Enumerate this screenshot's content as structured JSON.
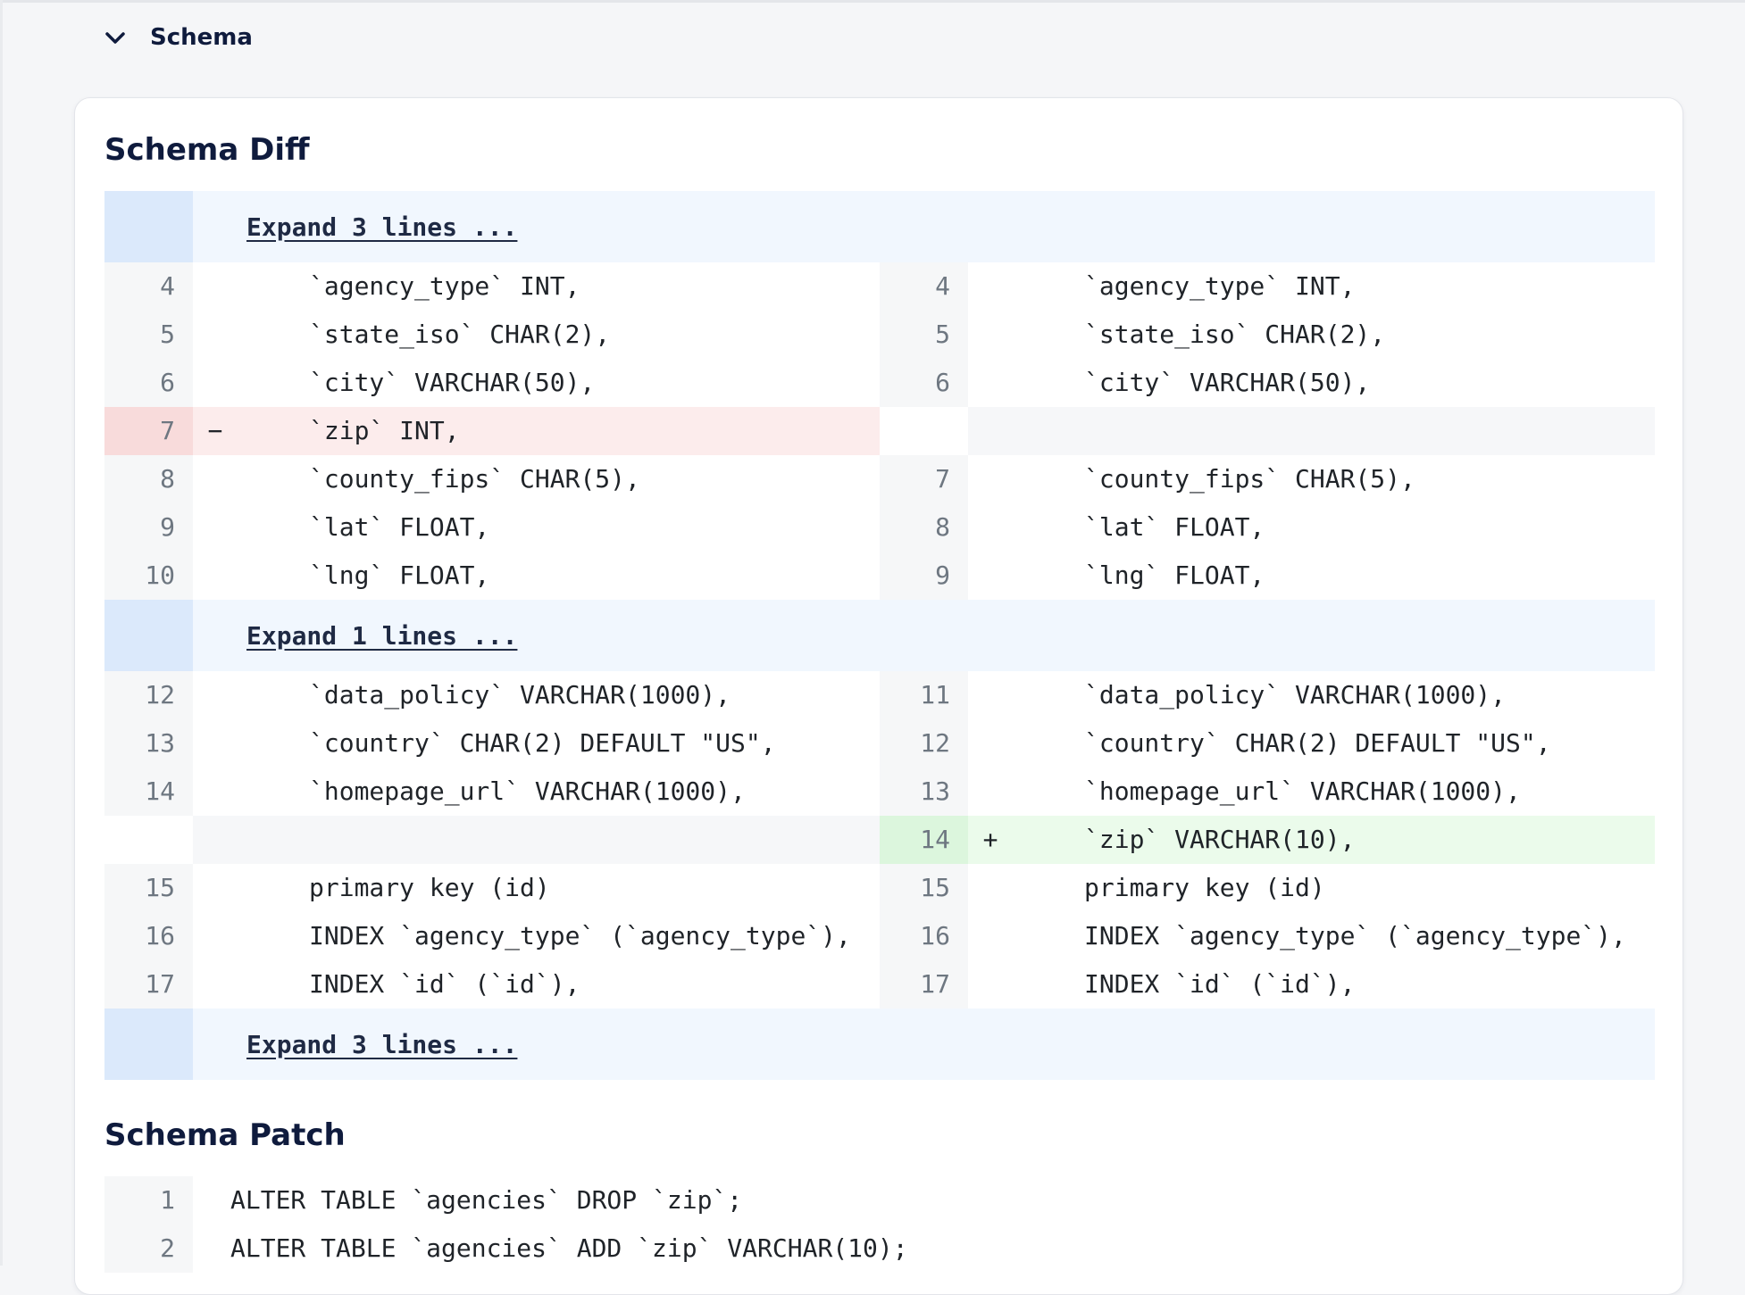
{
  "section": {
    "title": "Schema",
    "icon": "chevron-down-icon"
  },
  "diff": {
    "title": "Schema Diff",
    "expanders": [
      "Expand 3 lines ...",
      "Expand 1 lines ...",
      "Expand 3 lines ..."
    ],
    "blocks": [
      {
        "rows": [
          {
            "left_no": "4",
            "left": "`agency_type` INT,",
            "right_no": "4",
            "right": "`agency_type` INT,"
          },
          {
            "left_no": "5",
            "left": "`state_iso` CHAR(2),",
            "right_no": "5",
            "right": "`state_iso` CHAR(2),"
          },
          {
            "left_no": "6",
            "left": "`city` VARCHAR(50),",
            "right_no": "6",
            "right": "`city` VARCHAR(50),"
          },
          {
            "type": "del",
            "left_no": "7",
            "marker": "−",
            "left": "`zip` INT,",
            "right_no": "",
            "right": ""
          },
          {
            "left_no": "8",
            "left": "`county_fips` CHAR(5),",
            "right_no": "7",
            "right": "`county_fips` CHAR(5),"
          },
          {
            "left_no": "9",
            "left": "`lat` FLOAT,",
            "right_no": "8",
            "right": "`lat` FLOAT,"
          },
          {
            "left_no": "10",
            "left": "`lng` FLOAT,",
            "right_no": "9",
            "right": "`lng` FLOAT,"
          }
        ]
      },
      {
        "rows": [
          {
            "left_no": "12",
            "left": "`data_policy` VARCHAR(1000),",
            "right_no": "11",
            "right": "`data_policy` VARCHAR(1000),"
          },
          {
            "left_no": "13",
            "left": "`country` CHAR(2) DEFAULT \"US\",",
            "right_no": "12",
            "right": "`country` CHAR(2) DEFAULT \"US\","
          },
          {
            "left_no": "14",
            "left": "`homepage_url` VARCHAR(1000),",
            "right_no": "13",
            "right": "`homepage_url` VARCHAR(1000),"
          },
          {
            "type": "add",
            "left_no": "",
            "left": "",
            "right_no": "14",
            "marker": "+",
            "right": "`zip` VARCHAR(10),"
          },
          {
            "left_no": "15",
            "left": "primary key (id)",
            "right_no": "15",
            "right": "primary key (id)"
          },
          {
            "left_no": "16",
            "left": "INDEX `agency_type` (`agency_type`),",
            "right_no": "16",
            "right": "INDEX `agency_type` (`agency_type`),"
          },
          {
            "left_no": "17",
            "left": "INDEX `id` (`id`),",
            "right_no": "17",
            "right": "INDEX `id` (`id`),"
          }
        ]
      }
    ]
  },
  "patch": {
    "title": "Schema Patch",
    "lines": [
      {
        "no": "1",
        "code": "ALTER TABLE `agencies` DROP `zip`;"
      },
      {
        "no": "2",
        "code": "ALTER TABLE `agencies` ADD `zip` VARCHAR(10);"
      }
    ]
  }
}
